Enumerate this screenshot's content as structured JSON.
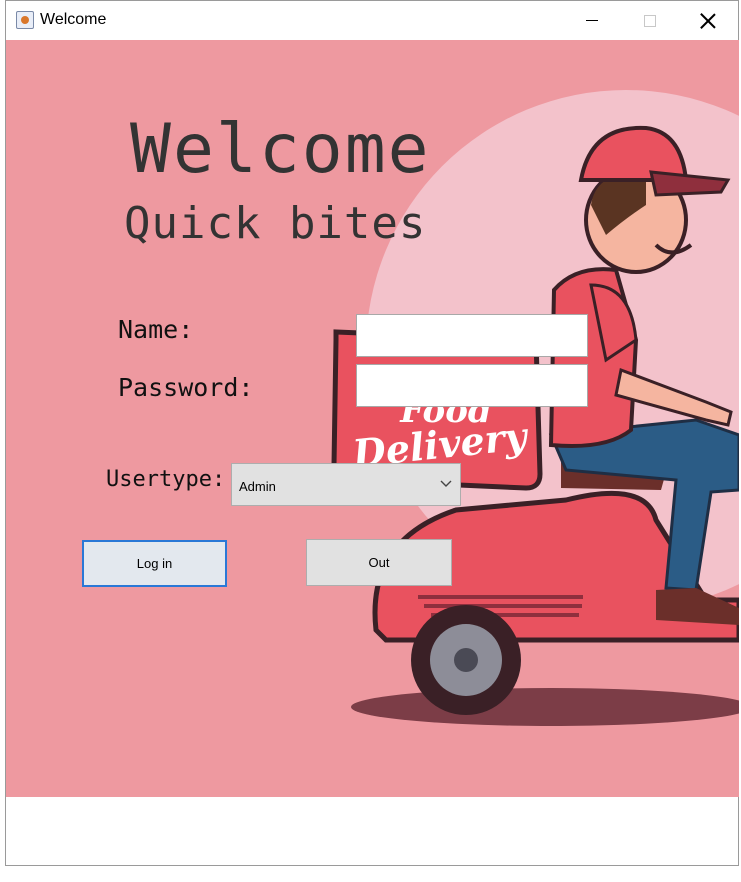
{
  "window": {
    "title": "Welcome"
  },
  "heading": {
    "title": "Welcome",
    "subtitle": "Quick bites"
  },
  "hero_image": {
    "sign_line1": "Food",
    "sign_line2": "Delivery"
  },
  "form": {
    "name_label": "Name:",
    "name_value": "",
    "password_label": "Password:",
    "password_value": "",
    "usertype_label": "Usertype:",
    "usertype_value": "Admin"
  },
  "buttons": {
    "login": "Log in",
    "out": "Out"
  },
  "colors": {
    "background": "#ee99a0",
    "circle": "#f3c2cb",
    "scooter": "#e9525f",
    "accent_focus": "#2a78d6"
  }
}
